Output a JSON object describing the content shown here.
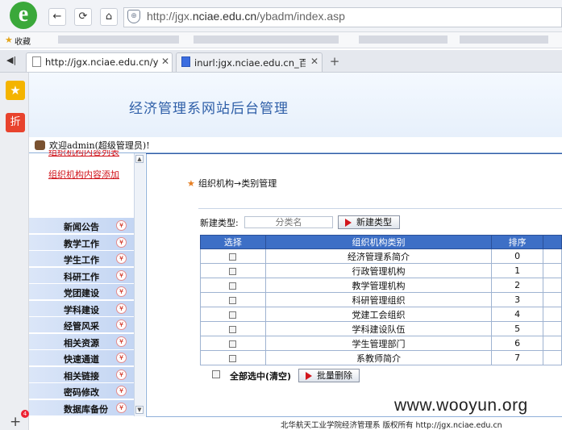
{
  "browser": {
    "url_prefix": "http://jgx.",
    "url_domain": "nciae.edu.cn",
    "url_suffix": "/ybadm/index.asp",
    "favorites_label": "收藏",
    "tabs": [
      {
        "label": "http://jgx.nciae.edu.cn/ybad",
        "active": true
      },
      {
        "label": "inurl:jgx.nciae.edu.cn_百度搜",
        "active": false
      }
    ],
    "side_buttons": [
      "收藏",
      "折"
    ],
    "plus_badge": "4"
  },
  "header": {
    "site_title": "经济管理系网站后台管理",
    "welcome": "欢迎admin(超级管理员)!"
  },
  "menu": {
    "top_links": [
      "组织机构内容列表",
      "组织机构内容添加"
    ],
    "items": [
      "新闻公告",
      "教学工作",
      "学生工作",
      "科研工作",
      "党团建设",
      "学科建设",
      "经管风采",
      "相关资源",
      "快速通道",
      "相关链接",
      "密码修改",
      "数据库备份"
    ]
  },
  "content": {
    "section_title": "组织机构→类别管理",
    "new_type_label": "新建类型:",
    "new_type_placeholder": "分类名",
    "new_type_button": "新建类型",
    "table_headers": [
      "选择",
      "组织机构类别",
      "排序"
    ],
    "rows": [
      {
        "name": "经济管理系简介",
        "order": "0"
      },
      {
        "name": "行政管理机构",
        "order": "1"
      },
      {
        "name": "教学管理机构",
        "order": "2"
      },
      {
        "name": "科研管理组织",
        "order": "3"
      },
      {
        "name": "党建工会组织",
        "order": "4"
      },
      {
        "name": "学科建设队伍",
        "order": "5"
      },
      {
        "name": "学生管理部门",
        "order": "6"
      },
      {
        "name": "系教师简介",
        "order": "7"
      }
    ],
    "select_all_label": "全部选中(清空)",
    "batch_delete_button": "批量删除"
  },
  "footer": {
    "text": "北华航天工业学院经济管理系 版权所有 http://jgx.nciae.edu.cn"
  },
  "watermark": "www.wooyun.org",
  "colors": {
    "header_blue": "#3d6fc6",
    "link_red": "#d0131a",
    "title_blue": "#2f5fa8"
  }
}
